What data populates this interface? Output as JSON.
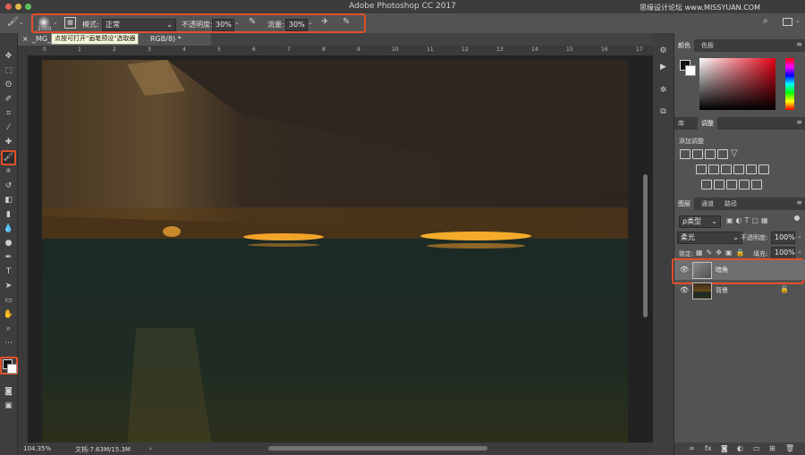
{
  "app": {
    "title": "Adobe Photoshop CC 2017",
    "watermark": "思缘设计论坛 www.MISSYUAN.COM"
  },
  "options_bar": {
    "brush_size": "1000",
    "mode_label": "模式:",
    "mode_value": "正常",
    "opacity_label": "不透明度:",
    "opacity_value": "30%",
    "flow_label": "流量:",
    "flow_value": "30%",
    "tooltip": "点按可打开\"画笔预设\"选取器"
  },
  "document": {
    "tab_prefix": "_MG_",
    "tab_suffix": "RGB/8) *"
  },
  "ruler": {
    "top_ticks": [
      "0",
      "1",
      "2",
      "3",
      "4",
      "5",
      "6",
      "7",
      "8",
      "9",
      "10",
      "11",
      "12",
      "13",
      "14",
      "15",
      "16",
      "17"
    ]
  },
  "status": {
    "zoom": "104.35%",
    "doc_size": "文档:7.63M/15.3M",
    "arrow": "›"
  },
  "panels": {
    "color": {
      "tabs": [
        "颜色",
        "色板"
      ],
      "active": 0
    },
    "adjust": {
      "tabs": [
        "库",
        "调整"
      ],
      "active": 1,
      "header": "添加调整"
    },
    "layers": {
      "tabs": [
        "图层",
        "通道",
        "路径"
      ],
      "active": 0,
      "filter_kind": "ρ类型",
      "blend_mode": "柔光",
      "opacity_label": "不透明度:",
      "opacity_value": "100%",
      "lock_label": "锁定:",
      "fill_label": "填充:",
      "fill_value": "100%",
      "items": [
        {
          "name": "暗角",
          "selected": true
        },
        {
          "name": "背景",
          "selected": false
        }
      ]
    }
  },
  "colors": {
    "highlight": "#e2502a",
    "panel_bg": "#535353",
    "dark_bg": "#3c3c3c"
  }
}
